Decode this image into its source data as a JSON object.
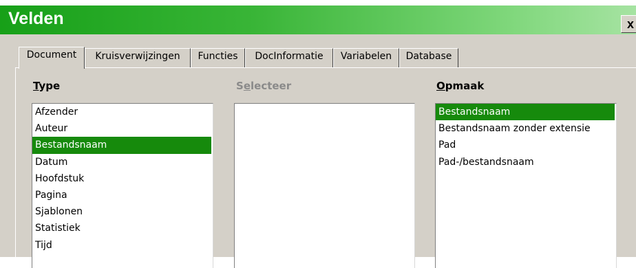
{
  "window": {
    "title": "Velden",
    "close_label": "x"
  },
  "tabs": [
    {
      "label": "Document",
      "active": true
    },
    {
      "label": "Kruisverwijzingen",
      "active": false
    },
    {
      "label": "Functies",
      "active": false
    },
    {
      "label": "DocInformatie",
      "active": false
    },
    {
      "label": "Variabelen",
      "active": false
    },
    {
      "label": "Database",
      "active": false
    }
  ],
  "type_column": {
    "label_mnemonic": "T",
    "label_rest": "ype",
    "items": [
      "Afzender",
      "Auteur",
      "Bestandsnaam",
      "Datum",
      "Hoofdstuk",
      "Pagina",
      "Sjablonen",
      "Statistiek",
      "Tijd"
    ],
    "selected": "Bestandsnaam"
  },
  "select_column": {
    "label_pre": "S",
    "label_mnemonic": "e",
    "label_rest": "lecteer",
    "items": []
  },
  "format_column": {
    "label_mnemonic": "O",
    "label_rest": "pmaak",
    "items": [
      "Bestandsnaam",
      "Bestandsnaam zonder extensie",
      "Pad",
      "Pad-/bestandsnaam"
    ],
    "selected": "Bestandsnaam"
  },
  "colors": {
    "title_gradient_start": "#17a018",
    "title_gradient_end": "#a6e3a2",
    "selection": "#168a0c",
    "dialog_bg": "#d4d0c8"
  }
}
